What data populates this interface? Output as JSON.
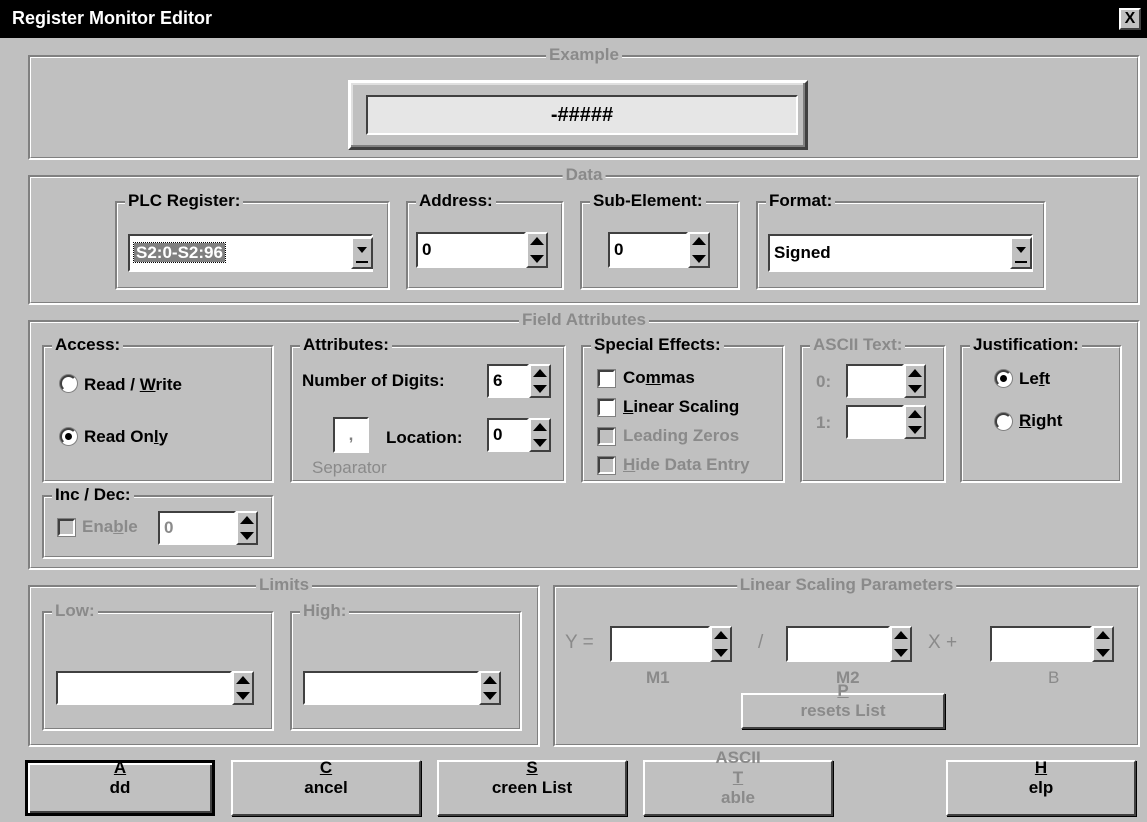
{
  "window": {
    "title": "Register Monitor Editor",
    "close_glyph": "X"
  },
  "example": {
    "label": "Example",
    "display_value": "-#####"
  },
  "data": {
    "label": "Data",
    "plc_register": {
      "label": "PLC Register:",
      "value": "S2:0-S2:96"
    },
    "address": {
      "label": "Address:",
      "value": "0"
    },
    "sub_element": {
      "label": "Sub-Element:",
      "value": "0"
    },
    "format": {
      "label": "Format:",
      "value": "Signed"
    }
  },
  "field_attributes": {
    "label": "Field Attributes",
    "access": {
      "label": "Access:",
      "read_write_pre": "Read / ",
      "read_write_u": "W",
      "read_write_post": "rite",
      "read_only_pre": "Read On",
      "read_only_u": "l",
      "read_only_post": "y",
      "selected": "Read Only"
    },
    "attributes": {
      "label": "Attributes:",
      "num_digits_label": "Number of Digits:",
      "num_digits_value": "6",
      "location_label": "Location:",
      "location_value": "0",
      "separator_value": ",",
      "separator_label": "Separator"
    },
    "special_effects": {
      "label": "Special Effects:",
      "commas_pre": "Co",
      "commas_u": "m",
      "commas_post": "mas",
      "linear_u": "L",
      "linear_post": "inear Scaling",
      "leading_zeros": "Leading Zeros",
      "hide_u": "H",
      "hide_post": "ide Data Entry"
    },
    "ascii_text": {
      "label": "ASCII Text:",
      "row0": "0:",
      "row1": "1:"
    },
    "justification": {
      "label": "Justification:",
      "left_pre": "Le",
      "left_u": "f",
      "left_post": "t",
      "right_u": "R",
      "right_post": "ight",
      "selected": "Left"
    },
    "inc_dec": {
      "label": "Inc / Dec:",
      "enable_pre": "Ena",
      "enable_u": "b",
      "enable_post": "le",
      "value": "0"
    }
  },
  "limits": {
    "label": "Limits",
    "low_label": "Low:",
    "high_label": "High:"
  },
  "linear_scaling": {
    "label": "Linear Scaling Parameters",
    "y_eq": "Y =",
    "slash": "/",
    "x_plus": "X +",
    "m1": "M1",
    "m2": "M2",
    "b": "B",
    "presets_u": "P",
    "presets_post": "resets List"
  },
  "buttons": {
    "add_u": "A",
    "add_post": "dd",
    "cancel_u": "C",
    "cancel_post": "ancel",
    "screen_u": "S",
    "screen_post": "creen List",
    "ascii_pre": "ASCII ",
    "ascii_u": "T",
    "ascii_post": "able",
    "help_u": "H",
    "help_post": "elp"
  }
}
